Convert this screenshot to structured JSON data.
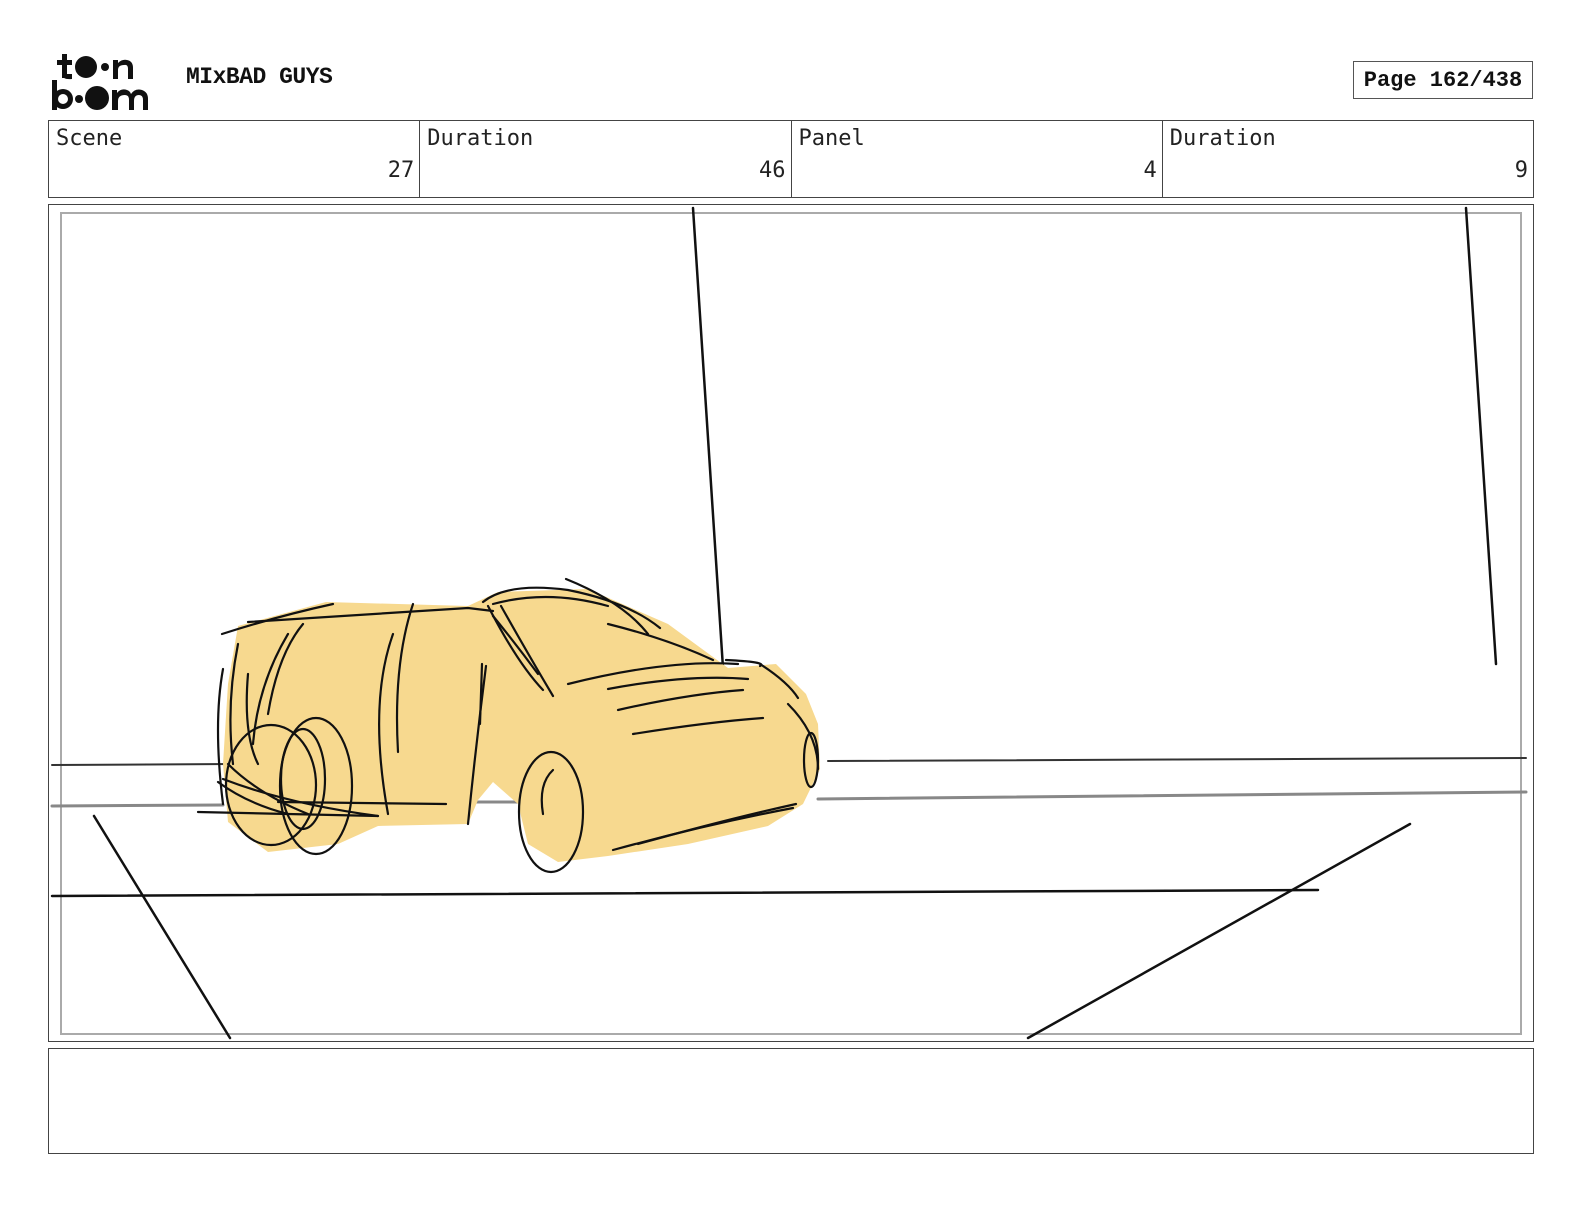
{
  "header": {
    "logo_text": "toon boom",
    "project_title": "MIxBAD GUYS",
    "page_label": "Page 162/438"
  },
  "info": {
    "scene_label": "Scene",
    "scene_value": "27",
    "scene_duration_label": "Duration",
    "scene_duration_value": "46",
    "panel_label": "Panel",
    "panel_value": "4",
    "panel_duration_label": "Duration",
    "panel_duration_value": "9"
  },
  "colors": {
    "car_fill": "#f7d98f",
    "ink": "#111111",
    "road_line": "#888888"
  },
  "notes": {
    "text": ""
  }
}
